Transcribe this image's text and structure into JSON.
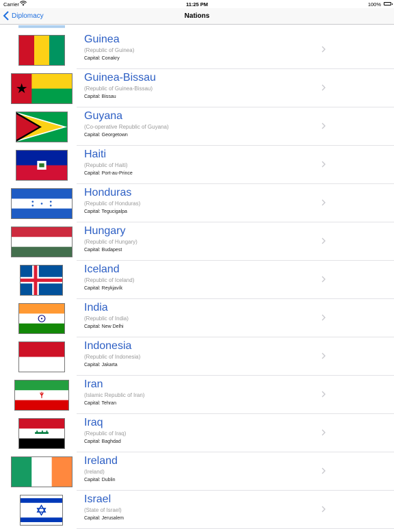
{
  "status_bar": {
    "carrier": "Carrier",
    "time": "11:25 PM",
    "battery": "100%"
  },
  "nav": {
    "back_label": "Diplomacy",
    "title": "Nations"
  },
  "colors": {
    "accent": "#2d5fc4",
    "back_link": "#1f6fde",
    "separator": "#e2e2e6"
  },
  "nations": [
    {
      "name": "Guinea",
      "official": "(Republic of Guinea)",
      "capital": "Capital: Conakry",
      "flag": "guinea-flag"
    },
    {
      "name": "Guinea-Bissau",
      "official": "(Republic of Guinea-Bissau)",
      "capital": "Capital: Bissau",
      "flag": "guinea-bissau-flag"
    },
    {
      "name": "Guyana",
      "official": "(Co-operative Republic of Guyana)",
      "capital": "Capital: Georgetown",
      "flag": "guyana-flag"
    },
    {
      "name": "Haiti",
      "official": "(Republic of Haiti)",
      "capital": "Capital: Port-au-Prince",
      "flag": "haiti-flag"
    },
    {
      "name": "Honduras",
      "official": "(Republic of Honduras)",
      "capital": "Capital: Tegucigalpa",
      "flag": "honduras-flag"
    },
    {
      "name": "Hungary",
      "official": "(Republic of Hungary)",
      "capital": "Capital: Budapest",
      "flag": "hungary-flag"
    },
    {
      "name": "Iceland",
      "official": "(Republic of Iceland)",
      "capital": "Capital: Reykjavík",
      "flag": "iceland-flag"
    },
    {
      "name": "India",
      "official": "(Republic of India)",
      "capital": "Capital: New Delhi",
      "flag": "india-flag"
    },
    {
      "name": "Indonesia",
      "official": "(Republic of Indonesia)",
      "capital": "Capital: Jakarta",
      "flag": "indonesia-flag"
    },
    {
      "name": "Iran",
      "official": "(Islamic Republic of Iran)",
      "capital": "Capital: Tehran",
      "flag": "iran-flag"
    },
    {
      "name": "Iraq",
      "official": "(Republic of Iraq)",
      "capital": "Capital: Baghdad",
      "flag": "iraq-flag"
    },
    {
      "name": "Ireland",
      "official": "(Ireland)",
      "capital": "Capital: Dublin",
      "flag": "ireland-flag"
    },
    {
      "name": "Israel",
      "official": "(State of Israel)",
      "capital": "Capital: Jerusalem",
      "flag": "israel-flag"
    }
  ]
}
